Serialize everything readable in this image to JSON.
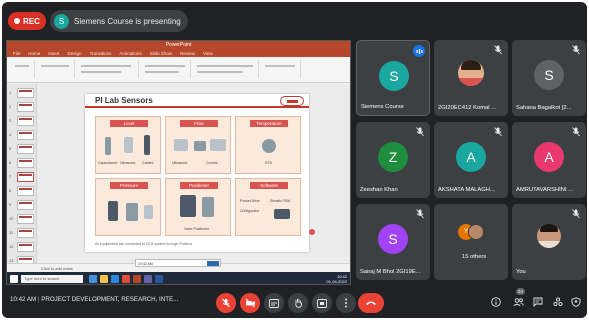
{
  "recording": {
    "label": "REC"
  },
  "presenter_banner": {
    "avatar_letter": "S",
    "text": "Siemens Course is presenting"
  },
  "shared_screen": {
    "app_title": "PowerPoint",
    "ribbon_tabs": [
      "File",
      "Home",
      "Insert",
      "Design",
      "Transitions",
      "Animations",
      "Slide Show",
      "Review",
      "View"
    ],
    "slide": {
      "title": "PI Lab Sensors",
      "cells": [
        {
          "label": "Level",
          "items": [
            "Capacitance",
            "Ultrasonic",
            "Guided"
          ]
        },
        {
          "label": "Flow",
          "items": [
            "Ultrasonic",
            "Coriolis"
          ]
        },
        {
          "label": "Temperature",
          "items": [
            "RTD"
          ]
        },
        {
          "label": "Pressure",
          "items": []
        },
        {
          "label": "Positioner",
          "items": [
            "Valve Positioner"
          ]
        },
        {
          "label": "Software",
          "items": [
            "Pocket Drive",
            "Simatic PDM",
            "Configurator"
          ]
        }
      ],
      "caption": "All equipments are connected to DCS system through Profibus"
    },
    "status_text": "Click to add notes",
    "taskbar_search": "Type here to search",
    "clock": {
      "time": "10:42",
      "date": "01-04-2022"
    }
  },
  "participants": [
    {
      "name": "Siemens Course",
      "letter": "S",
      "color": "#1aa7a0",
      "speaking": true
    },
    {
      "name": "2GI20EC412 Komal ...",
      "photo": true,
      "muted": true
    },
    {
      "name": "Sahana Bagalkot [2...",
      "letter": "S",
      "color": "#5f6368",
      "muted": true
    },
    {
      "name": "Zeeshan Khan",
      "letter": "Z",
      "color": "#1e8e3e",
      "muted": true
    },
    {
      "name": "AKSHATA MALAGH...",
      "letter": "A",
      "color": "#1aa7a0",
      "muted": true
    },
    {
      "name": "AMRUTAVARSHINI ...",
      "letter": "A",
      "color": "#e8386d",
      "muted": true
    },
    {
      "name": "Sairaj M Bhol 2GI19E...",
      "letter": "S",
      "color": "#a142f4",
      "muted": true
    },
    {
      "name": "15 others",
      "group": true
    },
    {
      "name": "You",
      "photo": true,
      "muted": true
    }
  ],
  "meeting_info": {
    "time": "10:42 AM",
    "title": "PROJECT DEVELOPMENT, RESEARCH, INTE..."
  },
  "controls": {
    "mic": "mic-off",
    "camera": "camera-off",
    "captions": "captions",
    "raise_hand": "raise-hand",
    "present": "present",
    "more": "more-options",
    "leave": "leave-call"
  },
  "right_controls": {
    "people_count": "24"
  }
}
